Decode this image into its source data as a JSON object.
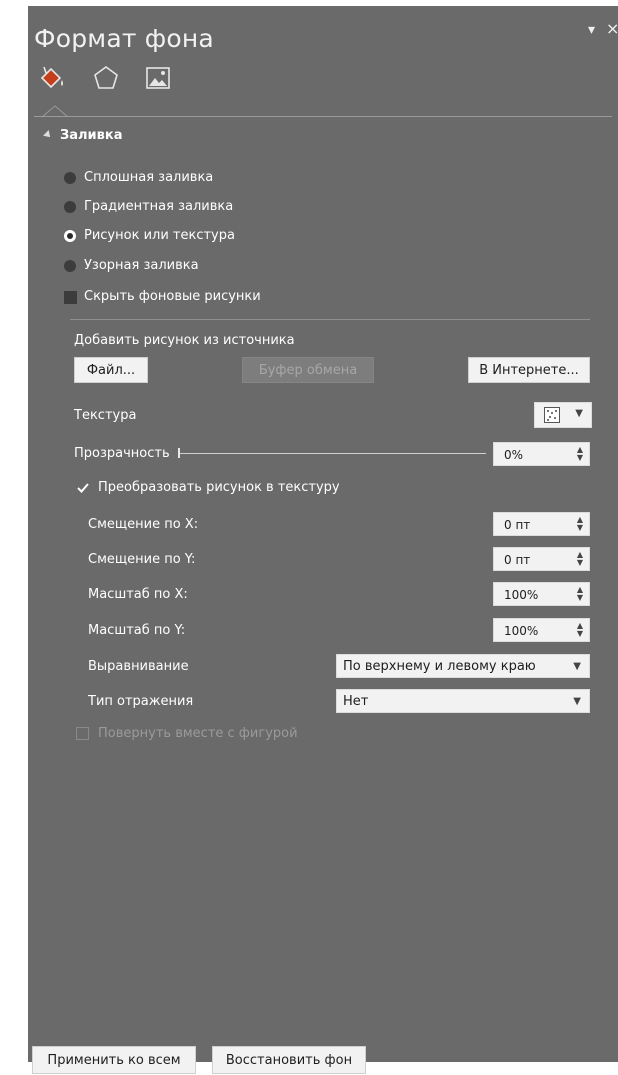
{
  "panel": {
    "title": "Формат фона",
    "controls": {
      "dropdown_glyph": "▾",
      "close_glyph": "×"
    },
    "tabs": [
      {
        "name": "fill-tab",
        "icon": "paint-bucket-icon"
      },
      {
        "name": "effects-tab",
        "icon": "pentagon-icon"
      },
      {
        "name": "picture-tab",
        "icon": "picture-icon"
      }
    ]
  },
  "fill": {
    "section_label": "Заливка",
    "options": [
      {
        "label": "Сплошная заливка",
        "selected": false
      },
      {
        "label": "Градиентная заливка",
        "selected": false
      },
      {
        "label": "Рисунок или текстура",
        "selected": true
      },
      {
        "label": "Узорная заливка",
        "selected": false
      }
    ],
    "hide_bg": {
      "label": "Скрыть фоновые рисунки",
      "checked": false
    },
    "insert_from_label": "Добавить рисунок из источника",
    "buttons": {
      "file": "Файл...",
      "clipboard": "Буфер обмена",
      "online": "В Интернете..."
    },
    "texture_label": "Текстура",
    "transparency": {
      "label": "Прозрачность",
      "value": "0%",
      "level": 0
    },
    "tile": {
      "label": "Преобразовать рисунок в текстуру",
      "checked": true
    },
    "offset_x": {
      "label": "Смещение по X:",
      "value": "0 пт"
    },
    "offset_y": {
      "label": "Смещение по Y:",
      "value": "0 пт"
    },
    "scale_x": {
      "label": "Масштаб по X:",
      "value": "100%"
    },
    "scale_y": {
      "label": "Масштаб по Y:",
      "value": "100%"
    },
    "alignment": {
      "label": "Выравнивание",
      "value": "По верхнему и левому краю"
    },
    "mirror": {
      "label": "Тип отражения",
      "value": "Нет"
    },
    "rotate": {
      "label": "Повернуть вместе с фигурой",
      "checked": false,
      "enabled": false
    }
  },
  "footer": {
    "apply_all": "Применить ко всем",
    "reset": "Восстановить фон"
  },
  "colors": {
    "pane_bg": "#6a6a6a",
    "accent_bucket": "#c43e1c"
  }
}
